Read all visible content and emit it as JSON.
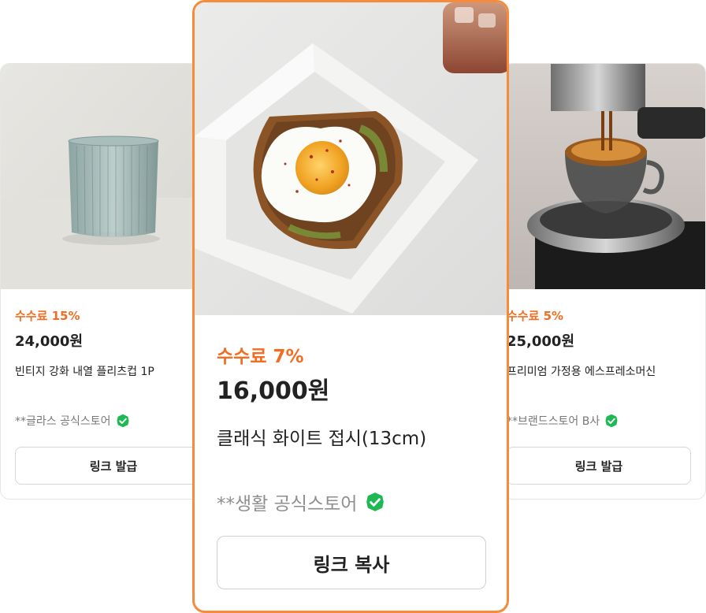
{
  "products": [
    {
      "fee": "수수료 15%",
      "price": "24,000원",
      "title": "빈티지 강화 내열 플리츠컵 1P",
      "store": "**글라스 공식스토어",
      "button": "링크 발급",
      "image": "fluted-glass-cup-photo"
    },
    {
      "fee": "수수료 7%",
      "price": "16,000원",
      "title": "클래식 화이트 접시(13cm)",
      "store": "**생활 공식스토어",
      "button": "링크 복사",
      "image": "egg-toast-on-white-plate-photo"
    },
    {
      "fee": "수수료 5%",
      "price": "25,000원",
      "title": "프리미엄 가정용 에스프레소머신",
      "store": "**브랜드스토어 B사",
      "button": "링크 발급",
      "image": "espresso-machine-photo"
    }
  ],
  "colors": {
    "accent": "#f26d21",
    "highlight_border": "#f58b3b",
    "verified_badge": "#1fb954"
  }
}
